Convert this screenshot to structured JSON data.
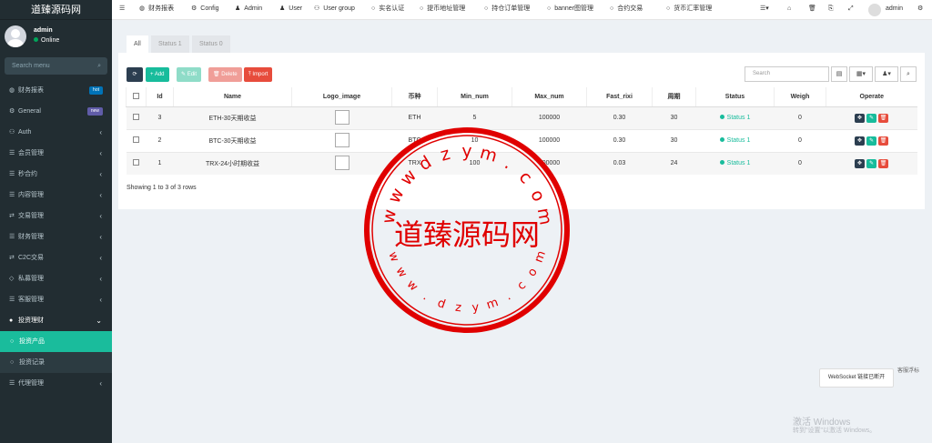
{
  "app_title": "道臻源码网",
  "user": {
    "name": "admin",
    "status": "Online"
  },
  "search_placeholder": "Search menu",
  "menu": [
    {
      "icon": "dashboard-icon",
      "glyph": "◍",
      "label": "财务报表",
      "badge": "hot",
      "badge_color": "#0073b7"
    },
    {
      "icon": "gears-icon",
      "glyph": "⚙",
      "label": "General",
      "badge": "new",
      "badge_color": "#605ca8"
    },
    {
      "icon": "group-icon",
      "glyph": "⚇",
      "label": "Auth",
      "arrow": "‹"
    },
    {
      "icon": "list-icon",
      "glyph": "☰",
      "label": "会员管理",
      "arrow": "‹"
    },
    {
      "icon": "list-icon",
      "glyph": "☰",
      "label": "秒合约",
      "arrow": "‹"
    },
    {
      "icon": "list-icon",
      "glyph": "☰",
      "label": "内容管理",
      "arrow": "‹"
    },
    {
      "icon": "exchange-icon",
      "glyph": "⇄",
      "label": "交易管理",
      "arrow": "‹"
    },
    {
      "icon": "list-icon",
      "glyph": "☰",
      "label": "财务管理",
      "arrow": "‹"
    },
    {
      "icon": "exchange-icon",
      "glyph": "⇄",
      "label": "C2C交易",
      "arrow": "‹"
    },
    {
      "icon": "diamond-icon",
      "glyph": "◇",
      "label": "私募管理",
      "arrow": "‹"
    },
    {
      "icon": "list-icon",
      "glyph": "☰",
      "label": "客服管理",
      "arrow": "‹"
    },
    {
      "icon": "circle-icon",
      "glyph": "●",
      "label": "投资理财",
      "arrow": "⌄",
      "open": true
    },
    {
      "icon": "circle-o-icon",
      "glyph": "○",
      "label": "投资产品",
      "sub": true,
      "active": true
    },
    {
      "icon": "circle-o-icon",
      "glyph": "○",
      "label": "投资记录",
      "sub": true
    },
    {
      "icon": "list-icon",
      "glyph": "☰",
      "label": "代理管理",
      "arrow": "‹"
    }
  ],
  "topnav": [
    {
      "glyph": "◍",
      "label": "财务报表"
    },
    {
      "glyph": "⚙",
      "label": "Config"
    },
    {
      "glyph": "♟",
      "label": "Admin"
    },
    {
      "glyph": "♟",
      "label": "User"
    },
    {
      "glyph": "⚇",
      "label": "User group"
    },
    {
      "glyph": "○",
      "label": "实名认证"
    },
    {
      "glyph": "○",
      "label": "提币地址管理"
    },
    {
      "glyph": "○",
      "label": "持仓订单管理"
    },
    {
      "glyph": "○",
      "label": "banner图管理"
    },
    {
      "glyph": "○",
      "label": "合约交易"
    },
    {
      "glyph": "○",
      "label": "货币汇率管理"
    }
  ],
  "topright": {
    "glyphs": [
      "☰▾",
      "⌂",
      "🗑",
      "⎘",
      "⤢"
    ],
    "user": "admin",
    "gear": "⚙"
  },
  "tabs": [
    "All",
    "Status 1",
    "Status 0"
  ],
  "toolbar": {
    "refresh": "⟳",
    "add": "+ Add",
    "edit": "✎ Edit",
    "delete": "🗑 Delete",
    "import": "⤒ Import",
    "search_placeholder": "Search",
    "view_glyphs": [
      "▤",
      "▦▾",
      "♟▾",
      "⌕"
    ]
  },
  "table": {
    "headers": [
      "",
      "Id",
      "Name",
      "Logo_image",
      "币种",
      "Min_num",
      "Max_num",
      "Fast_rixi",
      "周期",
      "Status",
      "Weigh",
      "Operate"
    ],
    "rows": [
      {
        "id": "3",
        "name": "ETH-30天期收益",
        "coin": "ETH",
        "min": "5",
        "max": "100000",
        "rixi": "0.30",
        "period": "30",
        "status": "Status 1",
        "weigh": "0"
      },
      {
        "id": "2",
        "name": "BTC-30天期收益",
        "coin": "BTC",
        "min": "10",
        "max": "100000",
        "rixi": "0.30",
        "period": "30",
        "status": "Status 1",
        "weigh": "0"
      },
      {
        "id": "1",
        "name": "TRX-24小时期收益",
        "coin": "TRX",
        "min": "100",
        "max": "100000",
        "rixi": "0.03",
        "period": "24",
        "status": "Status 1",
        "weigh": "0"
      }
    ]
  },
  "showing": "Showing 1 to 3 of 3 rows",
  "websocket": "WebSocket 链接已断开",
  "ws_image_alt": "客服浮标",
  "windows": {
    "line1": "激活 Windows",
    "line2": "转到\"设置\"以激活 Windows。"
  },
  "watermark": {
    "center": "道臻源码网",
    "top": "wwwdzym.com",
    "bottom": "www.dzym.com",
    "color": "#e00000"
  }
}
